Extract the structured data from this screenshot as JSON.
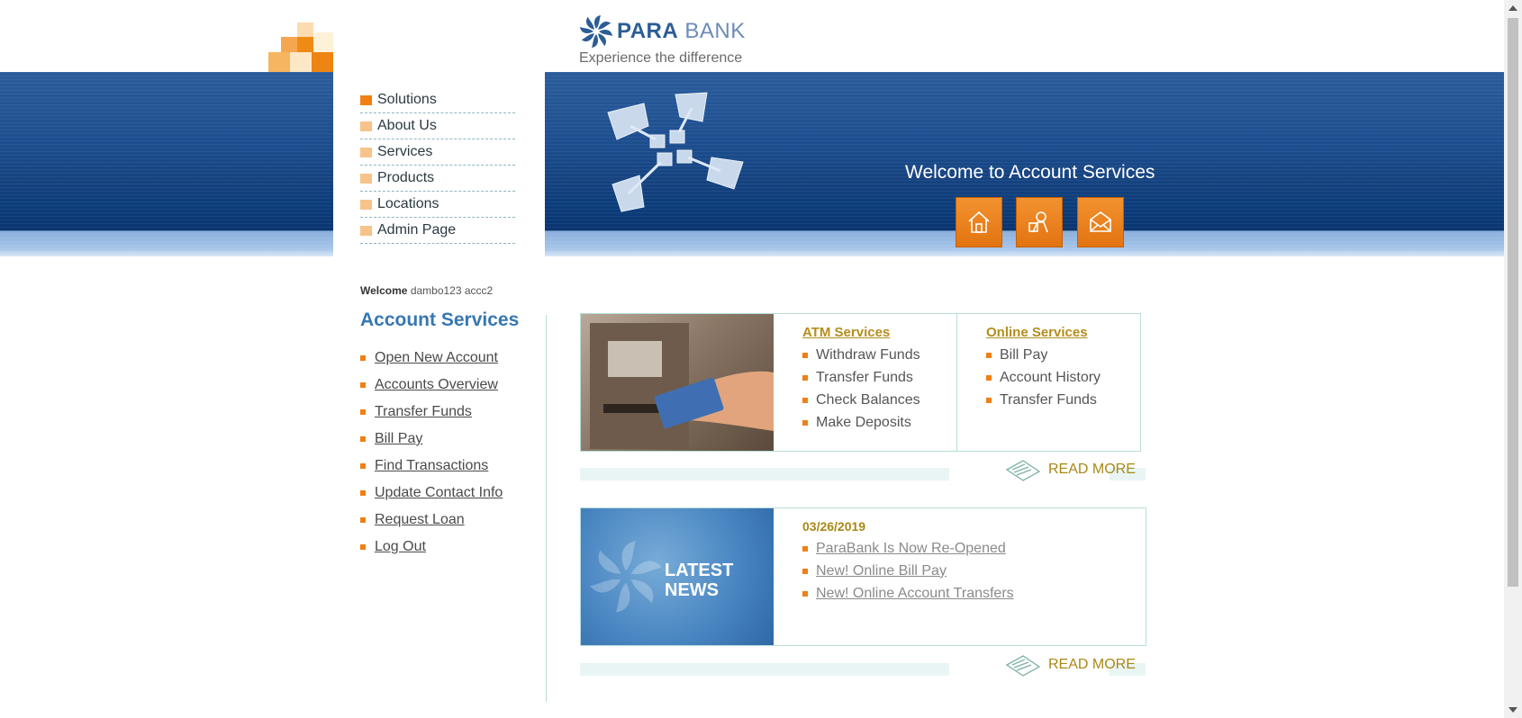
{
  "brand": {
    "name_part1": "PARA",
    "name_part2": "BANK",
    "tagline": "Experience the difference"
  },
  "top_nav": [
    {
      "label": "Solutions",
      "active": true
    },
    {
      "label": "About Us"
    },
    {
      "label": "Services"
    },
    {
      "label": "Products"
    },
    {
      "label": "Locations"
    },
    {
      "label": "Admin Page"
    }
  ],
  "hero": {
    "title": "Welcome to Account Services",
    "buttons": [
      "home-icon",
      "contact-icon",
      "mail-icon"
    ]
  },
  "sidebar": {
    "welcome_label": "Welcome",
    "user_name": "dambo123 accc2",
    "title": "Account Services",
    "links": [
      "Open New Account",
      "Accounts Overview",
      "Transfer Funds",
      "Bill Pay",
      "Find Transactions",
      "Update Contact Info",
      "Request Loan",
      "Log Out"
    ]
  },
  "services": {
    "atm": {
      "heading": "ATM Services",
      "items": [
        "Withdraw Funds",
        "Transfer Funds",
        "Check Balances",
        "Make Deposits"
      ]
    },
    "online": {
      "heading": "Online Services",
      "items": [
        "Bill Pay",
        "Account History",
        "Transfer Funds"
      ]
    },
    "read_more": "READ MORE"
  },
  "news": {
    "image_text_line1": "LATEST",
    "image_text_line2": "NEWS",
    "date": "03/26/2019",
    "items": [
      "ParaBank Is Now Re-Opened",
      "New! Online Bill Pay",
      "New! Online Account Transfers"
    ],
    "read_more": "READ MORE"
  },
  "colors": {
    "accent_orange": "#f08014",
    "brand_blue": "#2c5d95",
    "gold_link": "#b38e1c"
  }
}
